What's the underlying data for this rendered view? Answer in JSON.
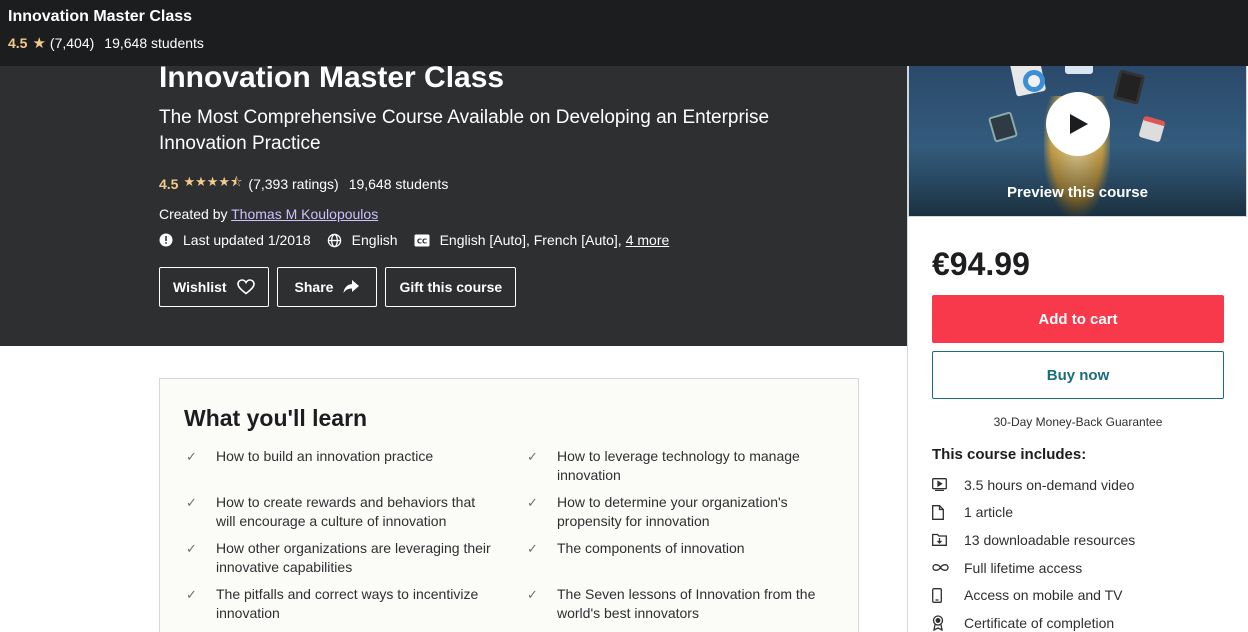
{
  "topbar": {
    "title": "Innovation Master Class",
    "rating": "4.5",
    "rating_count": "(7,404)",
    "students": "19,648 students"
  },
  "hero": {
    "title": "Innovation Master Class",
    "subtitle": "The Most Comprehensive Course Available on Developing an Enterprise Innovation Practice",
    "rating": "4.5",
    "stars": "★★★★⯪",
    "rating_count": "(7,393 ratings)",
    "students": "19,648 students",
    "created_by_label": "Created by",
    "instructor": "Thomas M Koulopoulos",
    "last_updated": "Last updated 1/2018",
    "language": "English",
    "captions": "English [Auto], French [Auto],",
    "captions_more": "4 more",
    "buttons": {
      "wishlist": "Wishlist",
      "share": "Share",
      "gift": "Gift this course"
    }
  },
  "learn": {
    "title": "What you'll learn",
    "items": [
      "How to build an innovation practice",
      "How to leverage technology to manage innovation",
      "How to create rewards and behaviors that will encourage a culture of innovation",
      "How to determine your organization's propensity for innovation",
      "How other organizations are leveraging their innovative capabilities",
      "The components of innovation",
      "The pitfalls and correct ways to incentivize innovation",
      "The Seven lessons of Innovation from the world's best innovators"
    ]
  },
  "card": {
    "preview_label": "Preview this course",
    "price": "€94.99",
    "add_to_cart": "Add to cart",
    "buy_now": "Buy now",
    "guarantee": "30-Day Money-Back Guarantee",
    "includes_title": "This course includes:",
    "includes": [
      {
        "icon": "video-icon",
        "label": "3.5 hours on-demand video"
      },
      {
        "icon": "file-icon",
        "label": "1 article"
      },
      {
        "icon": "folder-download-icon",
        "label": "13 downloadable resources"
      },
      {
        "icon": "infinity-icon",
        "label": "Full lifetime access"
      },
      {
        "icon": "mobile-icon",
        "label": "Access on mobile and TV"
      },
      {
        "icon": "certificate-icon",
        "label": "Certificate of completion"
      }
    ]
  },
  "colors": {
    "dark_bg": "#2d2f31",
    "topbar_bg": "#1c1d1f",
    "star": "#f3ca8c",
    "link": "#cec0fc",
    "cart": "#f8394c",
    "buy": "#1d6b7e"
  }
}
